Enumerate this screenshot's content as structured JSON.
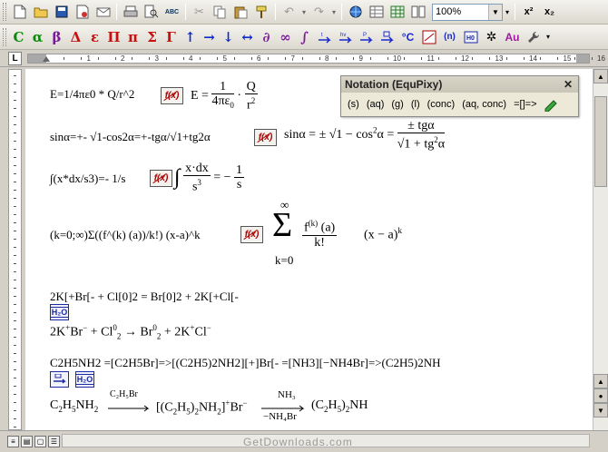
{
  "toolbar1": {
    "zoom_value": "100%",
    "superscript_label": "x²",
    "subscript_label": "x₂",
    "abc_label": "ABC"
  },
  "toolbar2": {
    "symbols": [
      "C",
      "α",
      "β",
      "Δ",
      "ε",
      "Π",
      "π",
      "Σ",
      "Γ"
    ],
    "arrows": [
      "↑",
      "→",
      "↓",
      "↔",
      "∂",
      "∞",
      "∫"
    ],
    "extras": [
      "(n)",
      "Au"
    ]
  },
  "ruler": {
    "corner_label": "L",
    "numbers": [
      "1",
      "2",
      "3",
      "4",
      "5",
      "6",
      "7",
      "8",
      "9",
      "10",
      "11",
      "12",
      "13",
      "14",
      "15",
      "16"
    ]
  },
  "palette": {
    "title": "Notation (EquPixy)",
    "buttons": [
      "(s)",
      "(aq)",
      "(g)",
      "(l)",
      "(conc)",
      "(aq, conc)",
      "=[]=>"
    ],
    "close_symbol": "✕"
  },
  "document": {
    "line1_text": "E=1/4πε0 * Q/r^2",
    "line1_rendered_prefix": "E =",
    "line1_frac1_num": "1",
    "line1_frac1_den": "4πε",
    "line1_frac1_den_sub": "0",
    "line1_frac2_num": "Q",
    "line1_frac2_den": "r",
    "line2_text": "sinα=+- √1-cos2α=+-tgα/√1+tg2α",
    "line2_rendered_a": "sinα = ± √1 − cos",
    "line2_rendered_a_sup": "2",
    "line2_rendered_a_end": "α =",
    "line2_frac_num": "± tgα",
    "line2_frac_den": "√1 + tg",
    "line2_frac_den_sup": "2",
    "line2_frac_den_end": "α",
    "line3_text": "∫(x*dx/s3)=- 1/s",
    "line3_int": "∫",
    "line3_frac1_num": "x·dx",
    "line3_frac1_den": "s",
    "line3_frac1_den_sup": "3",
    "line3_mid": "= −",
    "line3_frac2_num": "1",
    "line3_frac2_den": "s",
    "line4_text": "(k=0;∞)Σ((f^(k) (a))/k!) (x-a)^k",
    "line4_sum_top": "∞",
    "line4_sum": "Σ",
    "line4_sum_bottom": "k=0",
    "line4_frac_num": "f",
    "line4_frac_num_sup": "(k)",
    "line4_frac_num_end": " (a)",
    "line4_frac_den": "k!",
    "line4_tail": "(x − a)",
    "line4_tail_sup": "k",
    "line5_text": "2K[+Br[- + Cl[0]2 = Br[0]2 + 2K[+Cl[-",
    "line5_rendered_a": "2K",
    "line5_rendered_a_sup": "+",
    "line5_rendered_b": "Br",
    "line5_rendered_b_sup": "−",
    "line5_rendered_c": " + Cl",
    "line5_rendered_c_sup": "0",
    "line5_rendered_c_sub": "2",
    "line5_rendered_d": " → Br",
    "line5_rendered_d_sup": "0",
    "line5_rendered_d_sub": "2",
    "line5_rendered_e": " + 2K",
    "line5_rendered_e_sup": "+",
    "line5_rendered_f": "Cl",
    "line5_rendered_f_sup": "−",
    "h2o_label": "H₂O",
    "line6_text": "C2H5NH2 =[C2H5Br]=>[(C2H5)2NH2][+]Br[- =[NH3][−NH4Br]=>(C2H5)2NH",
    "line6_r1": "C",
    "line6_r1_s1": "2",
    "line6_r1_b": "H",
    "line6_r1_s2": "5",
    "line6_r1_c": "NH",
    "line6_r1_s3": "2",
    "line6_arrow1_top": "C₂H₅Br",
    "line6_mid": "[(C",
    "line6_mid_s1": "2",
    "line6_mid_b": "H",
    "line6_mid_s2": "5",
    "line6_mid_c": ")",
    "line6_mid_s3": "2",
    "line6_mid_d": "NH",
    "line6_mid_s4": "2",
    "line6_mid_e": "]",
    "line6_mid_sup": "+",
    "line6_mid_f": "Br",
    "line6_mid_sup2": "−",
    "line6_arrow2_top": "NH₃",
    "line6_arrow2_bottom": "−NH₄Br",
    "line6_end": "(C",
    "line6_end_s1": "2",
    "line6_end_b": "H",
    "line6_end_s2": "5",
    "line6_end_c": ")",
    "line6_end_s3": "2",
    "line6_end_d": "NH"
  },
  "watermark": "GetDownloads.com"
}
